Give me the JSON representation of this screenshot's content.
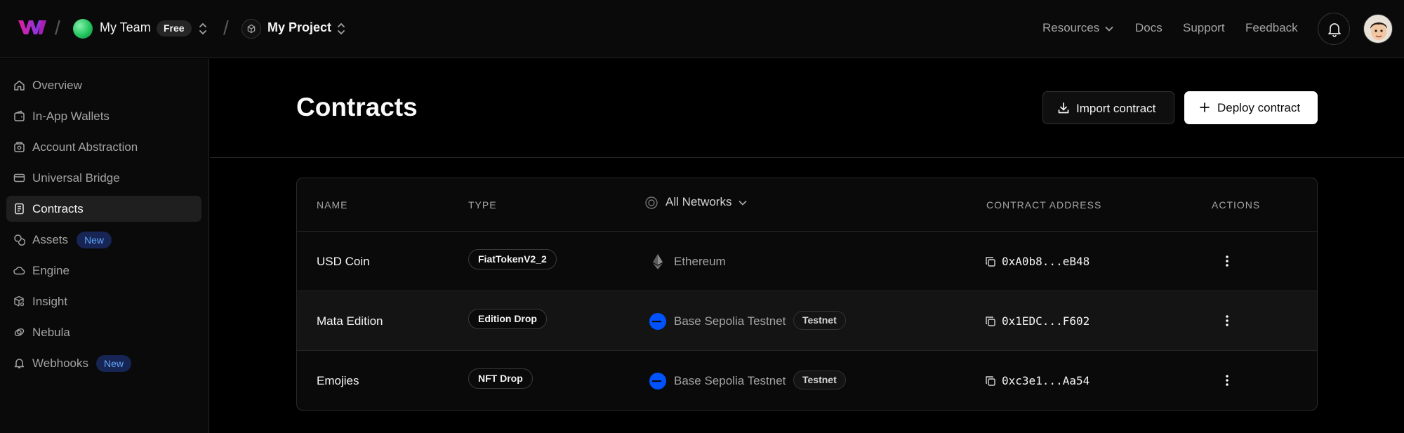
{
  "topbar": {
    "team_name": "My Team",
    "plan_badge": "Free",
    "project_name": "My Project",
    "nav": [
      "Resources",
      "Docs",
      "Support",
      "Feedback"
    ]
  },
  "sidebar": {
    "items": [
      {
        "label": "Overview",
        "icon": "home-icon"
      },
      {
        "label": "In-App Wallets",
        "icon": "wallet-icon"
      },
      {
        "label": "Account Abstraction",
        "icon": "smart-wallet-icon"
      },
      {
        "label": "Universal Bridge",
        "icon": "card-icon"
      },
      {
        "label": "Contracts",
        "icon": "contract-icon",
        "active": true
      },
      {
        "label": "Assets",
        "icon": "coins-icon",
        "badge": "New"
      },
      {
        "label": "Engine",
        "icon": "cloud-icon"
      },
      {
        "label": "Insight",
        "icon": "box-search-icon"
      },
      {
        "label": "Nebula",
        "icon": "nebula-icon"
      },
      {
        "label": "Webhooks",
        "icon": "bell-icon",
        "badge": "New"
      }
    ]
  },
  "main": {
    "title": "Contracts",
    "import_label": "Import contract",
    "deploy_label": "Deploy contract"
  },
  "table": {
    "headers": {
      "name": "NAME",
      "type": "TYPE",
      "network": "All Networks",
      "address": "CONTRACT ADDRESS",
      "actions": "ACTIONS"
    },
    "rows": [
      {
        "name": "USD Coin",
        "type": "FiatTokenV2_2",
        "network": "Ethereum",
        "testnet": "",
        "address": "0xA0b8...eB48"
      },
      {
        "name": "Mata Edition",
        "type": "Edition Drop",
        "network": "Base Sepolia Testnet",
        "testnet": "Testnet",
        "address": "0x1EDC...F602"
      },
      {
        "name": "Emojies",
        "type": "NFT Drop",
        "network": "Base Sepolia Testnet",
        "testnet": "Testnet",
        "address": "0xc3e1...Aa54"
      }
    ]
  },
  "colors": {
    "background": "#000000",
    "brand_gradient": [
      "#c026d3",
      "#7c3aed"
    ],
    "new_badge_bg": "#172554",
    "new_badge_text": "#60a5fa",
    "base_chain": "#0052ff"
  }
}
